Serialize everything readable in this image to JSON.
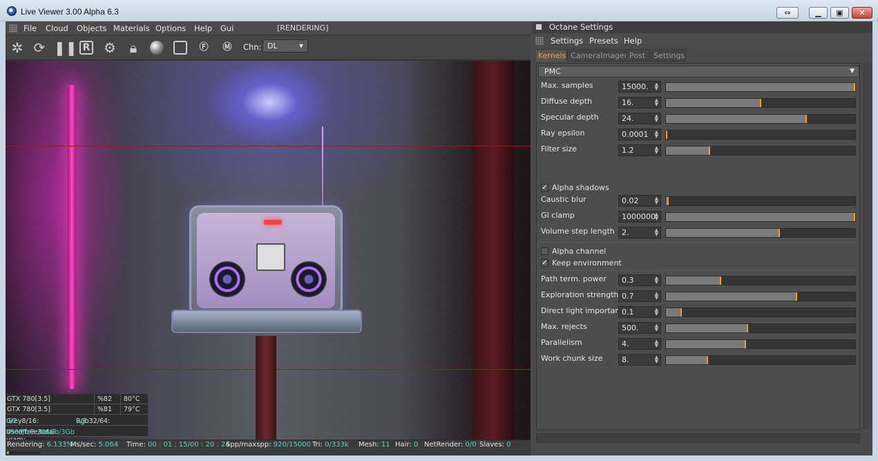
{
  "window": {
    "title": "Live Viewer 3.00 Alpha 6.3"
  },
  "viewer": {
    "menu": [
      "File",
      "Cloud",
      "Objects",
      "Materials",
      "Options",
      "Help",
      "Gui"
    ],
    "render_state": "[RENDERING]",
    "toolbar_icons": [
      "octane-logo-icon",
      "refresh-icon",
      "pause-icon",
      "r-icon",
      "gear-icon",
      "lock-icon",
      "sphere-icon",
      "region-icon",
      "f-pin-icon",
      "m-pin-icon"
    ],
    "channel_label": "Chn:",
    "channel_value": "DL"
  },
  "gpu_stats": [
    {
      "name": "GTX 780[3.5]",
      "usage": "%82",
      "temp": "80°C"
    },
    {
      "name": "GTX 780[3.5]",
      "usage": "%81",
      "temp": "79°C"
    }
  ],
  "memory": {
    "grey_label": "Grey8/16:",
    "grey_value": "0/2",
    "rgb_label": "Rgb32/64:",
    "rgb_value": "9/2",
    "vram_label": "Used/free/total vram:",
    "vram_value": "490Mb/2.308Gb/3Gb"
  },
  "status": {
    "rendering_label": "Rendering:",
    "rendering_value": "6.133%",
    "ms_label": "Ms/sec:",
    "ms_value": "5.064",
    "time_label": "Time:",
    "time_value": "00 : 01 : 15/00 : 20 : 24",
    "spp_label": "Spp/maxspp:",
    "spp_value": "920/15000",
    "tri_label": "Tri:",
    "tri_value": "0/333k",
    "mesh_label": "Mesh:",
    "mesh_value": "11",
    "hair_label": "Hair:",
    "hair_value": "0",
    "net_label": "NetRender:",
    "net_value": "0/0",
    "slaves_label": "Slaves:",
    "slaves_value": "0",
    "progress": 0.06133
  },
  "settings": {
    "title": "Octane Settings",
    "menu": [
      "Settings",
      "Presets",
      "Help"
    ],
    "tabs": [
      "Kernels",
      "CameraImager",
      "Post",
      "Settings"
    ],
    "kernel": "PMC",
    "params_group1": [
      {
        "label": "Max. samples",
        "value": "15000.",
        "fill": 1.0
      },
      {
        "label": "Diffuse depth",
        "value": "16.",
        "fill": 0.5
      },
      {
        "label": "Specular depth",
        "value": "24.",
        "fill": 0.74
      },
      {
        "label": "Ray epsilon",
        "value": "0.0001",
        "fill": 0.0
      },
      {
        "label": "Filter size",
        "value": "1.2",
        "fill": 0.23
      }
    ],
    "alpha_shadows": {
      "label": "Alpha shadows",
      "checked": true
    },
    "params_group2": [
      {
        "label": "Caustic blur",
        "value": "0.02",
        "fill": 0.01
      },
      {
        "label": "GI clamp",
        "value": "1000000.",
        "fill": 1.0
      },
      {
        "label": "Volume step length",
        "value": "2.",
        "fill": 0.6
      }
    ],
    "alpha_channel": {
      "label": "Alpha channel",
      "checked": false
    },
    "keep_environment": {
      "label": "Keep environment",
      "checked": true
    },
    "params_group3": [
      {
        "label": "Path term. power",
        "value": "0.3",
        "fill": 0.29
      },
      {
        "label": "Exploration strength",
        "value": "0.7",
        "fill": 0.69
      },
      {
        "label": "Direct light importan",
        "value": "0.1",
        "fill": 0.08
      },
      {
        "label": "Max. rejects",
        "value": "500.",
        "fill": 0.43
      },
      {
        "label": "Parallelism",
        "value": "4.",
        "fill": 0.42
      },
      {
        "label": "Work chunk size",
        "value": "8.",
        "fill": 0.22
      }
    ]
  }
}
